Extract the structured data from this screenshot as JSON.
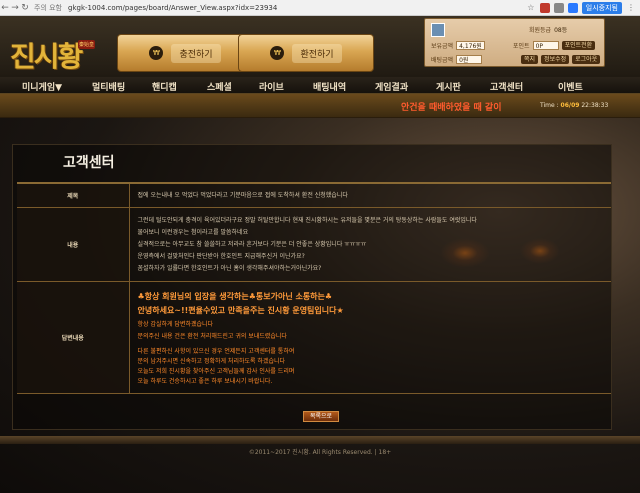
{
  "browser": {
    "info": "주의 요함",
    "url": "gkgk-1004.com/pages/board/Answer_View.aspx?idx=23934",
    "badge": "일시중지됨"
  },
  "header": {
    "logo": "진시황",
    "logo_sub": "秦始皇",
    "deposit_label": "충전하기",
    "withdraw_label": "환전하기",
    "deposit_icon": "coin-icon",
    "user": {
      "level_label": "회원등급",
      "level_value": "08등",
      "cash_label": "보유금액",
      "cash_value": "4,176원",
      "point_label": "포인트",
      "point_value": "0P",
      "bet_label": "배팅금액",
      "bet_value": "0원",
      "point_convert": "포인트전환",
      "memo": "쪽지",
      "info_edit": "정보수정",
      "logout": "로그아웃"
    }
  },
  "nav": [
    "미니게임▼",
    "멀티배팅",
    "핸디캡",
    "스페셜",
    "라이브",
    "배팅내역",
    "게임결과",
    "게시판",
    "고객센터",
    "이벤트"
  ],
  "ticker": {
    "message": "안건을 때배하였을 때 같이",
    "time_label": "Time :",
    "date": "06/09",
    "time": "22:38:33"
  },
  "page": {
    "title": "고객센터",
    "rows": [
      {
        "label": "제목",
        "lines": [
          "접에 오는내내 오 먹었다 먹었다라고 기분마음으로 접에 도착하셔 환전 신청했습니다"
        ]
      },
      {
        "label": "내용",
        "lines": [
          "그런데 털도안되게 충격이 육어있더라구요 정말 허탈만합니다 현재 진시황하시는 유저들을 몇분은 거의 탕동상하는 사람들도 여럿입니다",
          "물어보니 이런경우는 첨이라고를 말씀하네요",
          "실격적으로는   아무교도 참 쓸쓸하고 저라라 흔거보다 기분은 더 안좋은 상황입니다 ㅠㅠㅠㅠ",
          "운영측에서 걸맞처인다 판단받아 한호인트 지급해주신거 이닌가요?",
          "꼼설하자가 일률다면 한호인트가 아닌   홈이 생각해주셔야하는거아닌가요?"
        ]
      },
      {
        "label": "답변내용",
        "big_lines": [
          "♣항상 회원님의 입장을 생각하는♣통보가아닌 소통하는♣",
          "안녕하세요~!!편율수있고 만족을주는 진시황 운영팀입니다★"
        ],
        "lines": [
          "항상 감실하게 답변하곘습니다",
          "문의주신 내용 건은 환전 처리해드린고 귀의 보내드렸습니다",
          "다른 불편하신 사항이 있으신 경우 언제든지 고객센터를 통하여",
          "문의 남겨주시면 신속하고 정확하게 처리하도록 하겠습니다",
          "오늘도 저희 진시황을 찾아주신 고객님들께 감사 인사를 드리며",
          "오늘 하루도 건승하시고 좋은 하루 보내시기 바랍니다."
        ]
      }
    ],
    "list_button": "목록으로"
  },
  "footer": "©2011~2017 진시황. All Rights Reserved. | 18+"
}
